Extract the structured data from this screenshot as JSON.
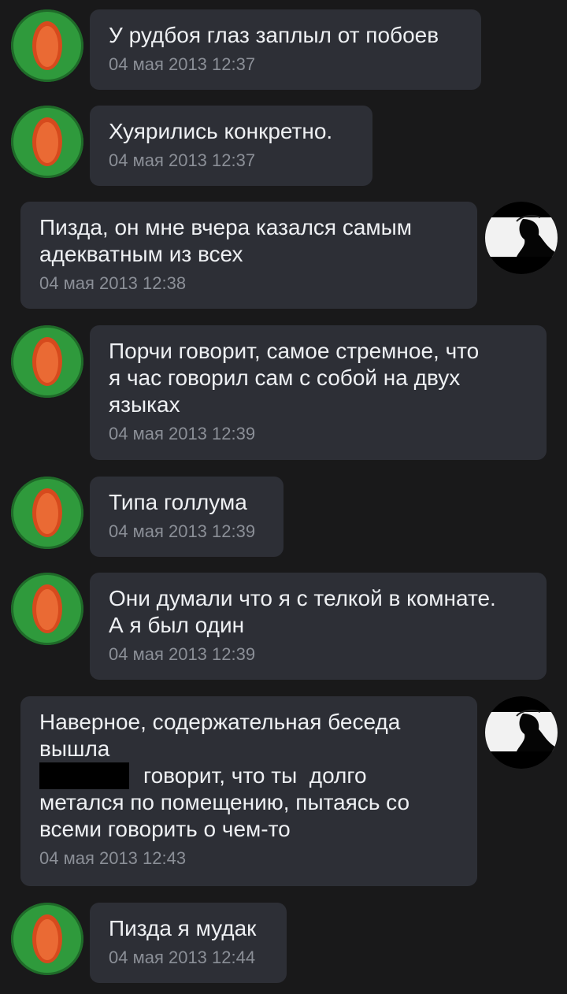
{
  "messages": [
    {
      "side": "left",
      "text": "У рудбоя глаз заплыл от побоев",
      "time": "04 мая 2013 12:37"
    },
    {
      "side": "left",
      "text": "Хуярились конкретно.",
      "time": "04 мая 2013 12:37"
    },
    {
      "side": "right",
      "text": "Пизда, он мне вчера казался самым\nадекватным из всех",
      "time": "04 мая 2013 12:38"
    },
    {
      "side": "left",
      "text": "Порчи говорит, самое стремное, что\nя час говорил сам с собой на двух\nязыках",
      "time": "04 мая 2013 12:39"
    },
    {
      "side": "left",
      "text": "Типа голлума",
      "time": "04 мая 2013 12:39"
    },
    {
      "side": "left",
      "text": "Они думали что я с телкой в комнате.\nА я был один",
      "time": "04 мая 2013 12:39"
    },
    {
      "side": "right",
      "text_line1": "Наверное, содержательная беседа\nвышла",
      "text_line2": "говорит, что ты  долго",
      "text_line3": "метался по помещению, пытаясь со\nвсеми говорить о чем-то",
      "time": "04 мая 2013 12:43"
    },
    {
      "side": "left",
      "text": "Пизда я мудак",
      "time": "04 мая 2013 12:44"
    }
  ],
  "colors": {
    "background": "#19191a",
    "bubble": "#2d2f36",
    "text": "#eef0f3",
    "time": "#8b8f97"
  },
  "icons": {
    "left_avatar": "red-flame-green-avatar",
    "right_avatar": "black-white-silhouette-avatar"
  }
}
